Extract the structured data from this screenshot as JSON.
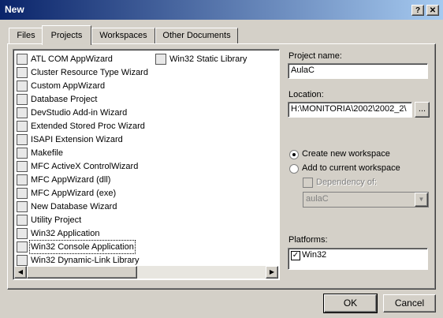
{
  "window": {
    "title": "New",
    "help_label": "?",
    "close_label": "✕"
  },
  "tabs": [
    {
      "label": "Files"
    },
    {
      "label": "Projects"
    },
    {
      "label": "Workspaces"
    },
    {
      "label": "Other Documents"
    }
  ],
  "projects_left": [
    {
      "label": "ATL COM AppWizard",
      "icon": "atl-icon"
    },
    {
      "label": "Cluster Resource Type Wizard",
      "icon": "cluster-icon"
    },
    {
      "label": "Custom AppWizard",
      "icon": "custom-appwizard-icon"
    },
    {
      "label": "Database Project",
      "icon": "database-icon"
    },
    {
      "label": "DevStudio Add-in Wizard",
      "icon": "addin-icon"
    },
    {
      "label": "Extended Stored Proc Wizard",
      "icon": "stored-proc-icon"
    },
    {
      "label": "ISAPI Extension Wizard",
      "icon": "isapi-icon"
    },
    {
      "label": "Makefile",
      "icon": "makefile-icon"
    },
    {
      "label": "MFC ActiveX ControlWizard",
      "icon": "activex-icon"
    },
    {
      "label": "MFC AppWizard (dll)",
      "icon": "mfc-dll-icon"
    },
    {
      "label": "MFC AppWizard (exe)",
      "icon": "mfc-exe-icon"
    },
    {
      "label": "New Database Wizard",
      "icon": "new-database-icon"
    },
    {
      "label": "Utility Project",
      "icon": "utility-icon"
    },
    {
      "label": "Win32 Application",
      "icon": "win32-app-icon"
    },
    {
      "label": "Win32 Console Application",
      "icon": "console-icon",
      "selected": true
    },
    {
      "label": "Win32 Dynamic-Link Library",
      "icon": "dll-icon"
    }
  ],
  "projects_right": [
    {
      "label": "Win32 Static Library",
      "icon": "static-lib-icon"
    }
  ],
  "form": {
    "project_name_label": "Project name:",
    "project_name_value": "AulaC",
    "location_label": "Location:",
    "location_value": "H:\\MONITORIA\\2002\\2002_2\\",
    "browse_label": "...",
    "create_new_label": "Create new workspace",
    "add_current_label": "Add to current workspace",
    "dependency_label": "Dependency of:",
    "dependency_value": "aulaC",
    "platforms_label": "Platforms:",
    "platform_item": "Win32"
  },
  "buttons": {
    "ok": "OK",
    "cancel": "Cancel"
  }
}
